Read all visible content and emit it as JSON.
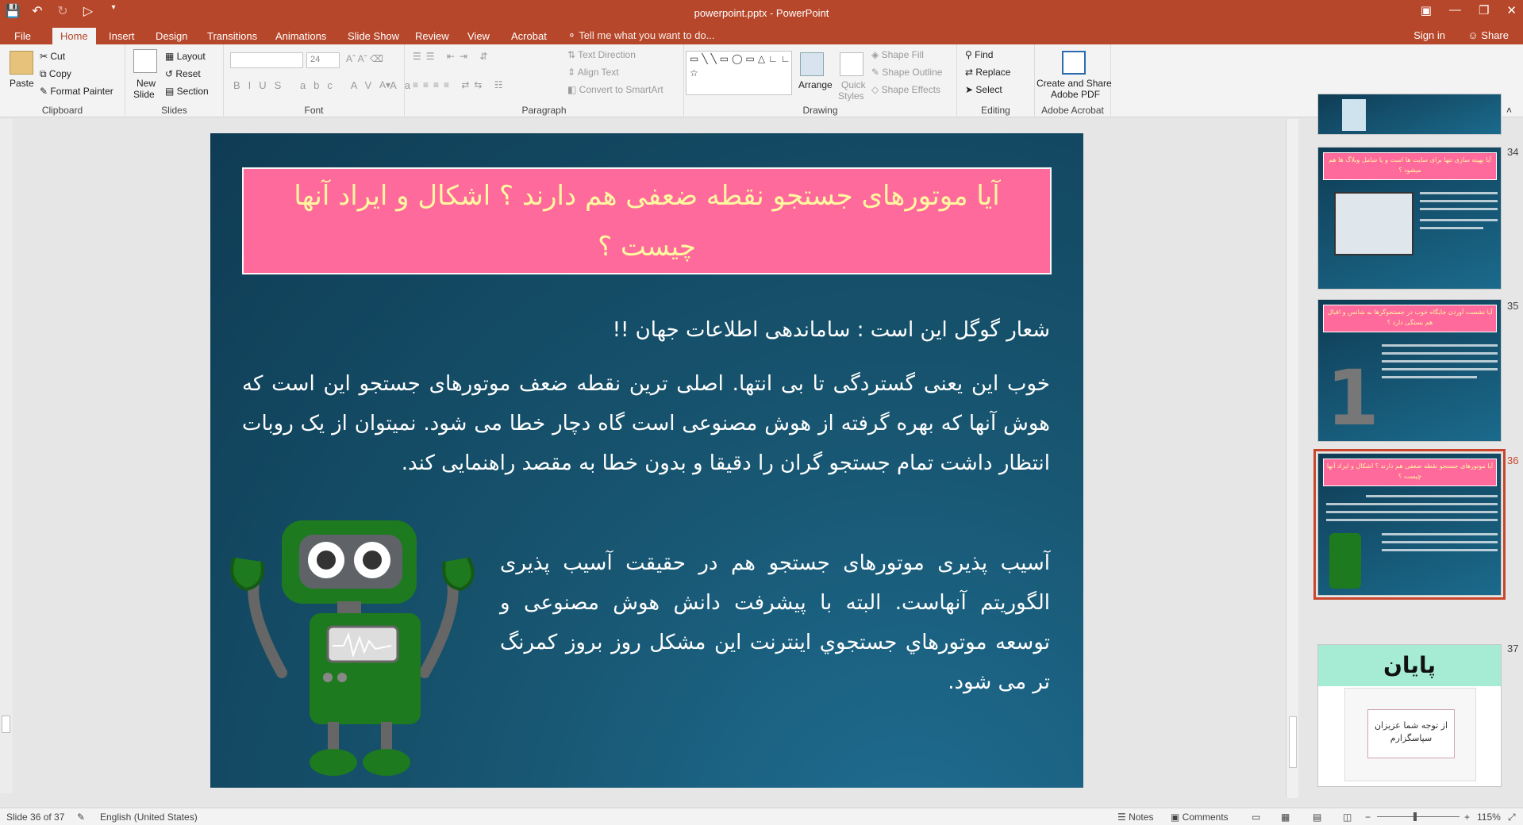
{
  "window": {
    "title": "powerpoint.pptx - PowerPoint"
  },
  "tabs": {
    "items": [
      "File",
      "Home",
      "Insert",
      "Design",
      "Transitions",
      "Animations",
      "Slide Show",
      "Review",
      "View",
      "Acrobat"
    ],
    "tell_me": "Tell me what you want to do...",
    "sign_in": "Sign in",
    "share": "Share"
  },
  "ribbon": {
    "clipboard": {
      "paste": "Paste",
      "cut": "Cut",
      "copy": "Copy",
      "format_painter": "Format Painter",
      "label": "Clipboard"
    },
    "slides": {
      "new_slide_1": "New",
      "new_slide_2": "Slide",
      "layout": "Layout",
      "reset": "Reset",
      "section": "Section",
      "label": "Slides"
    },
    "font": {
      "size": "24",
      "label": "Font"
    },
    "paragraph": {
      "text_direction": "Text Direction",
      "align_text": "Align Text",
      "convert_smartart": "Convert to SmartArt",
      "label": "Paragraph"
    },
    "drawing": {
      "arrange": "Arrange",
      "quick_styles_1": "Quick",
      "quick_styles_2": "Styles",
      "shape_fill": "Shape Fill",
      "shape_outline": "Shape Outline",
      "shape_effects": "Shape Effects",
      "label": "Drawing"
    },
    "editing": {
      "find": "Find",
      "replace": "Replace",
      "select": "Select",
      "label": "Editing"
    },
    "acrobat": {
      "create_1": "Create and Share",
      "create_2": "Adobe PDF",
      "label": "Adobe Acrobat"
    }
  },
  "slide": {
    "title": "آیا موتورهای جستجو نقطه ضعفی هم دارند ؟ اشکال و ایراد آنها چیست ؟",
    "p1": "شعار گوگل این است : ساماندهی اطلاعات جهان !!",
    "p2": "خوب این یعنی گستردگی تا بی انتها. اصلی ترین نقطه ضعف موتورهای جستجو این است که هوش آنها که بهره گرفته از هوش مصنوعی است گاه دچار خطا می شود. نمیتوان از یک روبات انتظار داشت تمام جستجو گران را دقیقا و بدون خطا به مقصد راهنمایی کند.",
    "p3": "آسیب پذیری موتورهای جستجو هم در حقیقت آسیب پذیری الگوریتم آنهاست. البته با پیشرفت دانش هوش مصنوعی و توسعه موتورهاي جستجوي اينترنت اين مشكل روز بروز كمرنگ تر می شود."
  },
  "thumbnails": [
    {
      "num": "34",
      "title": "آیا بهینه سازی تنها برای سایت ها است و یا شامل وبلاگ ها هم میشود ؟"
    },
    {
      "num": "35",
      "title": "آیا نشست آوردن جایگاه خوب در جستجوگرها به شانس و اقبال هم بستگی دارد ؟"
    },
    {
      "num": "36",
      "title": "آیا موتورهای جستجو نقطه ضعفی هم دارند ؟ اشکال و ایراد آنها چیست ؟"
    },
    {
      "num": "37",
      "end_title": "پایان",
      "card_1": "از توجه شما عزیزان",
      "card_2": "سپاسگزارم"
    }
  ],
  "status": {
    "slide_of": "Slide 36 of 37",
    "language": "English (United States)",
    "notes": "Notes",
    "comments": "Comments",
    "zoom": "115%"
  },
  "colors": {
    "accent": "#b7472a",
    "title_box": "#ff6a9c",
    "title_text": "#fff8a0",
    "slide_bg": "#17546f",
    "selected": "#c8462c"
  }
}
